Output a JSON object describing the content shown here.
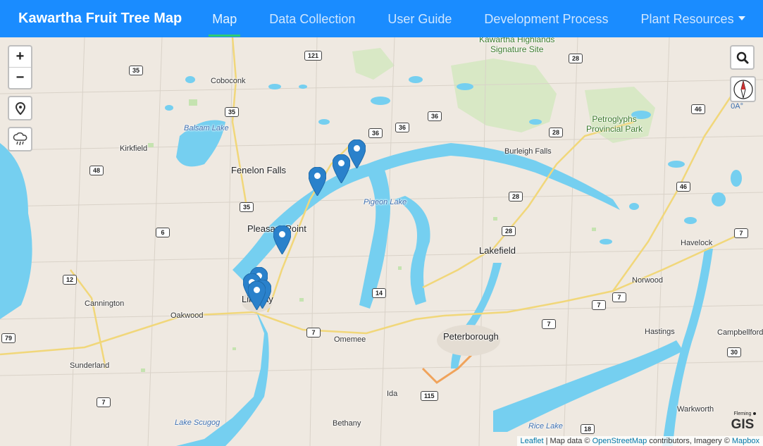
{
  "navbar": {
    "brand": "Kawartha Fruit Tree Map",
    "items": [
      {
        "label": "Map",
        "active": true
      },
      {
        "label": "Data Collection"
      },
      {
        "label": "User Guide"
      },
      {
        "label": "Development Process"
      },
      {
        "label": "Plant Resources",
        "dropdown": true
      }
    ],
    "colors": {
      "background": "#1a8cff",
      "active_underline": "#2ecc71"
    }
  },
  "map_controls": {
    "zoom_in": "+",
    "zoom_out": "−",
    "locate_icon": "location-pin-icon",
    "weather_icon": "rain-cloud-icon",
    "search_icon": "search-icon",
    "compass_icon": "compass-icon",
    "compass_reading": "0A°"
  },
  "places": {
    "coboconk": "Coboconk",
    "balsam_lake": "Balsam Lake",
    "kirkfield": "Kirkfield",
    "fenelon_falls": "Fenelon Falls",
    "pleasant_point": "Pleasant Point",
    "pigeon_lake": "Pigeon Lake",
    "burleigh_falls": "Burleigh Falls",
    "kawartha_highlands": "Kawartha Highlands\nSignature Site",
    "petroglyphs": "Petroglyphs\nProvincial Park",
    "lakefield": "Lakefield",
    "havelock": "Havelock",
    "norwood": "Norwood",
    "cannington": "Cannington",
    "oakwood": "Oakwood",
    "lindsay": "Lindsay",
    "omemee": "Omemee",
    "peterborough": "Peterborough",
    "hastings": "Hastings",
    "campbellford": "Campbellford",
    "sunderland": "Sunderland",
    "ida": "Ida",
    "lake_scugog": "Lake Scugog",
    "bethany": "Bethany",
    "rice_lake": "Rice Lake",
    "warkworth": "Warkworth"
  },
  "highways": {
    "h121": "121",
    "h35a": "35",
    "h35b": "35",
    "h35c": "35",
    "h28a": "28",
    "h28b": "28",
    "h28c": "28",
    "h28d": "28",
    "h36a": "36",
    "h36b": "36",
    "h36c": "36",
    "h46a": "46",
    "h46b": "46",
    "h48": "48",
    "h6": "6",
    "h12": "12",
    "h14": "14",
    "h7a": "7",
    "h7b": "7",
    "h7c": "7",
    "h7d": "7",
    "h7e": "7",
    "h7f": "7",
    "h79": "79",
    "h115": "115",
    "h30": "30",
    "h18": "18"
  },
  "attribution": {
    "leaflet": "Leaflet",
    "sep1": " | Map data © ",
    "osm": "OpenStreetMap",
    "sep2": " contributors, Imagery © ",
    "mapbox": "Mapbox"
  },
  "logo": {
    "line1": "Fleming",
    "line2": "GIS"
  }
}
